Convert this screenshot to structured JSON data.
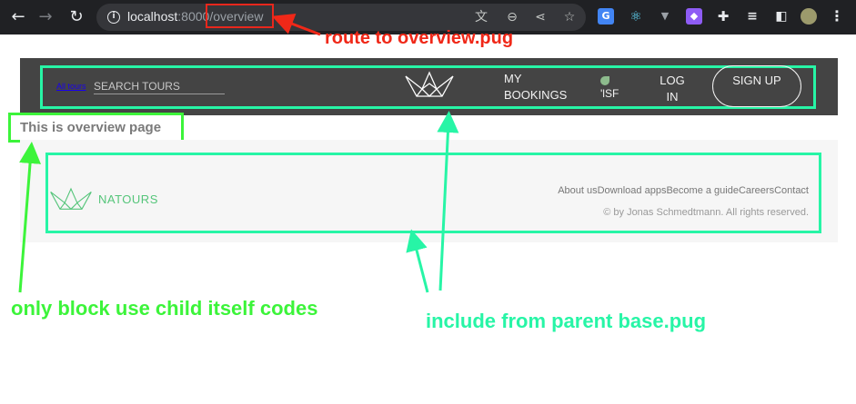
{
  "browser": {
    "url_host": "localhost",
    "url_port": ":8000",
    "url_path": "/overview"
  },
  "header": {
    "all_tours": "All tours",
    "search_placeholder": "SEARCH TOURS",
    "my_bookings": "MY BOOKINGS",
    "user_alt": "'lSF",
    "login": "LOG IN",
    "signup": "SIGN UP"
  },
  "content": {
    "title": "This is overview page"
  },
  "footer": {
    "brand": "NATOURS",
    "nav": [
      "About us",
      "Download apps",
      "Become a guide",
      "Careers",
      "Contact"
    ],
    "copyright": "© by Jonas Schmedtmann. All rights reserved."
  },
  "annotations": {
    "route": "route to overview.pug",
    "block": "only block use child itself codes",
    "include": "include from parent base.pug"
  },
  "colors": {
    "annotation_red": "#f02818",
    "annotation_green": "#3cf43a",
    "annotation_teal": "#27f5a6",
    "header_bg": "#444444",
    "brand_green": "#55c57a"
  }
}
